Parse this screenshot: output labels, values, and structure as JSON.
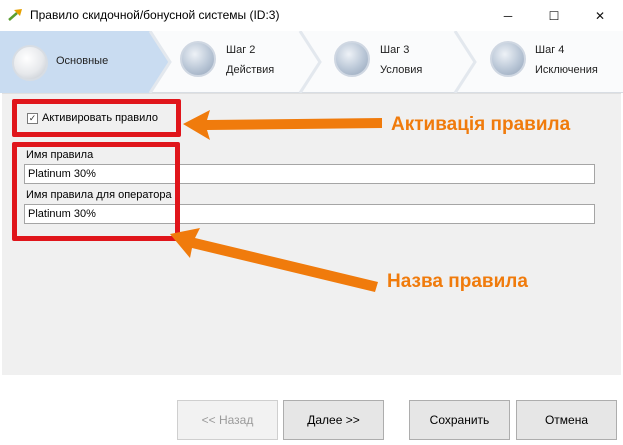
{
  "window": {
    "title": "Правило скидочной/бонусной системы (ID:3)",
    "icon": "arrow-app-icon",
    "controls": {
      "minimize": "─",
      "maximize": "☐",
      "close": "✕"
    }
  },
  "wizard": {
    "steps": [
      {
        "line1": "",
        "line2": "Основные",
        "active": true
      },
      {
        "line1": "Шаг 2",
        "line2": "Действия",
        "active": false
      },
      {
        "line1": "Шаг 3",
        "line2": "Условия",
        "active": false
      },
      {
        "line1": "Шаг 4",
        "line2": "Исключения",
        "active": false
      }
    ]
  },
  "form": {
    "activate_checkbox": {
      "label": "Активировать правило",
      "checked": true,
      "mark": "✓"
    },
    "rule_name": {
      "label": "Имя правила",
      "value": "Platinum 30%"
    },
    "operator_name": {
      "label": "Имя правила для оператора",
      "value": "Platinum 30%"
    }
  },
  "annotations": {
    "activation": "Активація правила",
    "name": "Назва правила",
    "colors": {
      "box": "#e0151b",
      "arrow": "#f07b0c"
    }
  },
  "buttons": {
    "back": "<< Назад",
    "next": "Далее >>",
    "save": "Сохранить",
    "cancel": "Отмена"
  }
}
